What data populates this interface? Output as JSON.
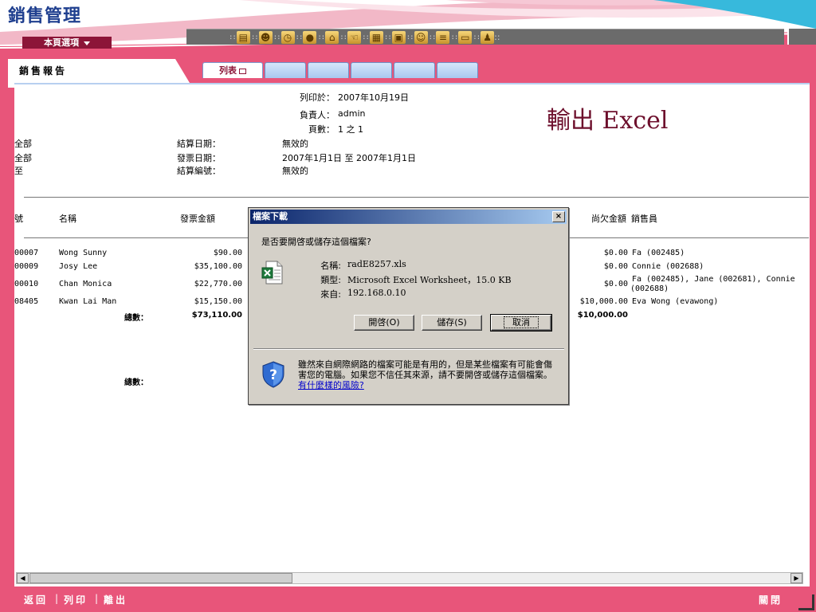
{
  "header": {
    "app_title": "銷售管理",
    "page_menu_label": "本頁選項",
    "toolbar_icons": [
      "books-icon",
      "users-icon",
      "clock-icon",
      "coin-icon",
      "house-icon",
      "hand-icon",
      "calculator-icon",
      "clipboard-icon",
      "group-icon",
      "notepad-icon",
      "monitor-icon",
      "people-icon"
    ]
  },
  "panel": {
    "label": "銷售報告",
    "tabs": [
      {
        "label": "列表",
        "active": true
      },
      {
        "label": ""
      },
      {
        "label": ""
      },
      {
        "label": ""
      },
      {
        "label": ""
      },
      {
        "label": ""
      }
    ]
  },
  "report": {
    "print_date_label": "列印於：",
    "print_date": "2007年10月19日",
    "owner_label": "負責人：",
    "owner": "admin",
    "pages_label": "頁數：",
    "pages": "1 之 1",
    "export_note": "輸出 Excel",
    "left_fragments": [
      "全部",
      "全部",
      "至"
    ],
    "settle_date_label": "結算日期：",
    "settle_date": "無效的",
    "invoice_date_label": "發票日期：",
    "invoice_date": "2007年1月1日 至 2007年1月1日",
    "settle_no_label": "結算編號：",
    "settle_no": "無效的",
    "columns": {
      "no": "號",
      "name": "名稱",
      "invoice_amount": "發票金額",
      "outstanding": "尚欠金額",
      "salesperson": "銷售員"
    },
    "rows": [
      {
        "no": "00007",
        "name": "Wong Sunny",
        "amount": "$90.00",
        "outstanding": "$0.00",
        "sales": "Fa (002485)"
      },
      {
        "no": "00009",
        "name": "Josy Lee",
        "amount": "$35,100.00",
        "outstanding": "$0.00",
        "sales": "Connie (002688)"
      },
      {
        "no": "00010",
        "name": "Chan Monica",
        "amount": "$22,770.00",
        "outstanding": "$0.00",
        "sales": "Fa (002485), Jane (002681), Connie",
        "sales_2": "(002688)"
      },
      {
        "no": "08405",
        "name": "Kwan Lai Man",
        "amount": "$15,150.00",
        "outstanding": "$10,000.00",
        "sales": "Eva Wong (evawong)"
      }
    ],
    "total_label": "總數：",
    "total_amount": "$73,110.00",
    "total_outstanding": "$10,000.00",
    "total_label_2": "總數："
  },
  "dialog": {
    "title": "檔案下載",
    "close": "×",
    "question": "是否要開啓或儲存這個檔案?",
    "name_label": "名稱:",
    "name": "radE8257.xls",
    "type_label": "類型:",
    "type": "Microsoft Excel Worksheet，15.0 KB",
    "from_label": "來自:",
    "from": "192.168.0.10",
    "open_button": "開啓(O)",
    "save_button": "儲存(S)",
    "cancel_button": "取消",
    "warning": "雖然來自網際網路的檔案可能是有用的，但是某些檔案有可能會傷害您的電腦。如果您不信任其來源，請不要開啓或儲存這個檔案。",
    "warning_link": "有什麼樣的風險?"
  },
  "footer": {
    "back": "返回",
    "print": "列印",
    "logout": "離出",
    "close": "關閉"
  }
}
